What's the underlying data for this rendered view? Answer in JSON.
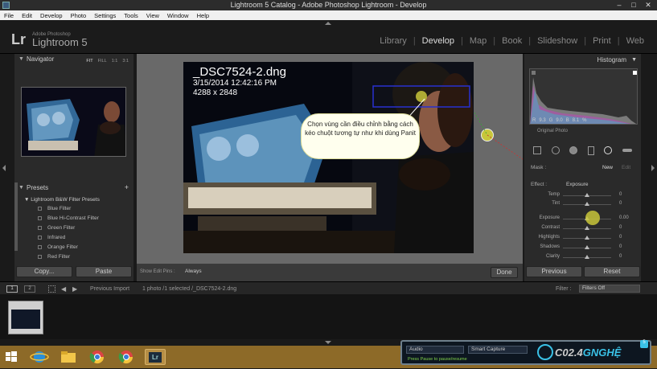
{
  "window": {
    "title": "Lightroom 5 Catalog - Adobe Photoshop Lightroom - Develop",
    "controls": {
      "minimize": "–",
      "maximize": "□",
      "close": "✕"
    }
  },
  "menu": [
    "File",
    "Edit",
    "Develop",
    "Photo",
    "Settings",
    "Tools",
    "View",
    "Window",
    "Help"
  ],
  "identity": {
    "logo": "Lr",
    "brand_small": "Adobe Photoshop",
    "brand": "Lightroom 5"
  },
  "modules": [
    {
      "label": "Library",
      "active": false
    },
    {
      "label": "Develop",
      "active": true
    },
    {
      "label": "Map",
      "active": false
    },
    {
      "label": "Book",
      "active": false
    },
    {
      "label": "Slideshow",
      "active": false
    },
    {
      "label": "Print",
      "active": false
    },
    {
      "label": "Web",
      "active": false
    }
  ],
  "navigator": {
    "title": "Navigator",
    "zoom_options": [
      "FIT",
      "FILL",
      "1:1",
      "3:1"
    ],
    "zoom_selected": "FIT"
  },
  "presets": {
    "title": "Presets",
    "add": "+",
    "folder": "Lightroom B&W Filter Presets",
    "items": [
      "Blue Filter",
      "Blue Hi-Contrast Filter",
      "Green Filter",
      "Infrared",
      "Orange Filter",
      "Red Filter"
    ]
  },
  "left_buttons": {
    "copy": "Copy...",
    "paste": "Paste"
  },
  "photo": {
    "filename": "_DSC7524-2.dng",
    "date": "3/15/2014 12:42:16 PM",
    "dimensions": "4288 x 2848",
    "callout": "Chọn vùng cần điều chỉnh bằng cách kéo chuột tương tự như khi dùng Panit"
  },
  "toolbar": {
    "show_edit_pins_label": "Show Edit Pins :",
    "show_edit_pins_value": "Always",
    "done": "Done"
  },
  "histogram": {
    "title": "Histogram",
    "r_label": "R",
    "r": "9.3",
    "g_label": "G",
    "g": "9.0",
    "b_label": "B",
    "b": "8.1",
    "unit": "%",
    "original_photo": "Original Photo"
  },
  "mask": {
    "label": "Mask :",
    "new": "New",
    "edit": "Edit"
  },
  "effect": {
    "label": "Effect :",
    "value": "Exposure"
  },
  "sliders": [
    {
      "name": "Temp",
      "value": "0",
      "level": 0.5
    },
    {
      "name": "Tint",
      "value": "0",
      "level": 0.5
    },
    {
      "name": "Exposure",
      "value": "0.00",
      "level": 0.5
    },
    {
      "name": "Contrast",
      "value": "0",
      "level": 0.5
    },
    {
      "name": "Highlights",
      "value": "0",
      "level": 0.5
    },
    {
      "name": "Shadows",
      "value": "0",
      "level": 0.5
    },
    {
      "name": "Clarity",
      "value": "0",
      "level": 0.5
    }
  ],
  "right_buttons": {
    "previous": "Previous",
    "reset": "Reset"
  },
  "filmstrip": {
    "page1": "1",
    "page2": "2",
    "source": "Previous Import",
    "count": "1 photo /1 selected /_DSC7524-2.dng",
    "filter_label": "Filter :",
    "filter_value": "Filters Off"
  },
  "recorder": {
    "audio": "Audio",
    "capture": "Smart Capture",
    "hint": "Press Pause to pause/resume",
    "brand_pre": "C",
    "brand_mid": "02.4",
    "brand_hi": "GNGHỆ",
    "version": "5"
  },
  "colors": {
    "accent_blue": "#3ac1e6",
    "callout_fill": "#ffffee",
    "taskbar": "#8d6a28"
  }
}
